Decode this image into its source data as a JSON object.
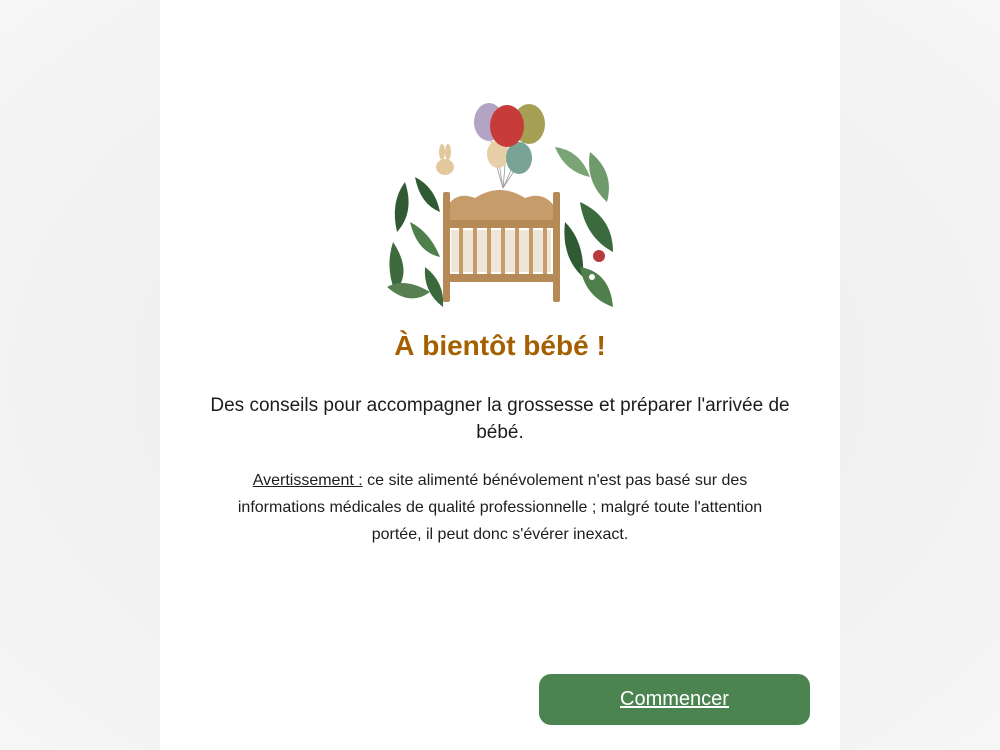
{
  "welcome": {
    "title": "À bientôt bébé !",
    "lead": "Des conseils pour accompagner la grossesse et préparer l'arrivée de bébé.",
    "warning_label": "Avertissement :",
    "warning_text": " ce site alimenté bénévolement n'est pas basé sur des informations médicales de qualité professionnelle ; malgré toute l'attention portée, il peut donc s'évérer inexact."
  },
  "actions": {
    "start_label": "Commencer"
  },
  "colors": {
    "title": "#a46000",
    "button": "#4c8451",
    "text": "#1d1d1d"
  },
  "illustration": {
    "icon": "crib-with-balloons-illustration"
  }
}
